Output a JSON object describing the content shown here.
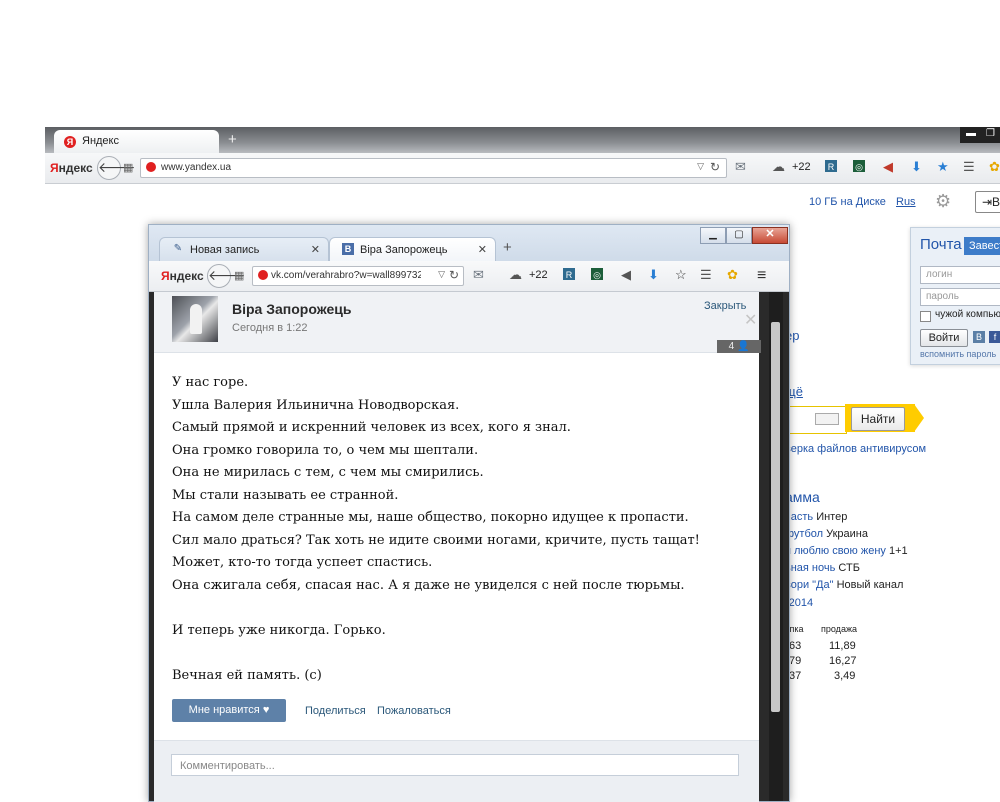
{
  "back_window": {
    "tab_title": "Яндекс",
    "favicon_letter": "Я",
    "new_tab": "+",
    "logo": "Яндекс",
    "url": "www.yandex.ua",
    "weather_temp": "+22",
    "disk_link": "10 ГБ на Диске",
    "lang_link": "Rus",
    "login_label": "В",
    "mail": {
      "title": "Почта",
      "signup": "Завест",
      "login_placeholder": "логин",
      "password_placeholder": "пароль",
      "foreign_pc": "чужой компьют",
      "enter_button": "Войти",
      "vk_letter": "В",
      "fb_letter": "f",
      "forgot": "вспомнить пароль"
    },
    "link_partial_1": "ер",
    "link_partial_2": "щё",
    "find_button": "Найти",
    "antivirus_link": "верка файлов антивирусом",
    "tv_title": "амма",
    "tv_rows": [
      {
        "show": "часть",
        "channel": "Интер"
      },
      {
        "show": "футбол",
        "channel": "Украина"
      },
      {
        "show": "я люблю свою жену",
        "channel": "1+1"
      },
      {
        "show": "ьная ночь",
        "channel": "СТБ"
      },
      {
        "show": "вори \"Да\"",
        "channel": "Новый канал"
      },
      {
        "show": "-2014",
        "channel": ""
      }
    ],
    "currency": {
      "buy_header": "упка",
      "sell_header": "продажа",
      "rows": [
        {
          "buy": "63",
          "sell": "11,89"
        },
        {
          "buy": "79",
          "sell": "16,27"
        },
        {
          "buy": "37",
          "sell": "3,49"
        }
      ]
    }
  },
  "front_window": {
    "tabs": [
      {
        "title": "Новая запись"
      },
      {
        "title": "Віра Запорожець",
        "favicon": "B"
      }
    ],
    "new_tab": "+",
    "logo": "Яндекс",
    "url": "vk.com/verahrabro?w=wall8997320_9",
    "weather_temp": "+22"
  },
  "post": {
    "author": "Віра Запорожець",
    "time": "Сегодня в 1:22",
    "close_label": "Закрыть",
    "lines": [
      "У нас горе.",
      "Ушла Валерия Ильинична Новодворская.",
      "Самый прямой и искренний человек из всех, кого я знал.",
      "Она громко говорила то, о чем мы шептали.",
      "Она не мирилась с тем, с чем мы смирились.",
      "Мы стали называть ее странной.",
      "На самом деле странные мы, наше общество, покорно идущее к пропасти.",
      "Сил мало драться? Так хоть не идите своими ногами, кричите, пусть тащат!",
      "Может, кто-то тогда успеет спастись.",
      "Она сжигала себя, спасая нас. А я даже не увиделся с ней после тюрьмы."
    ],
    "line_after_1": "И теперь уже никогда. Горько.",
    "line_after_2": "Вечная ей память. (с)",
    "like_label": "Мне нравится",
    "share_label": "Поделиться",
    "report_label": "Пожаловаться",
    "comment_placeholder": "Комментировать...",
    "viewers_count": "4"
  }
}
